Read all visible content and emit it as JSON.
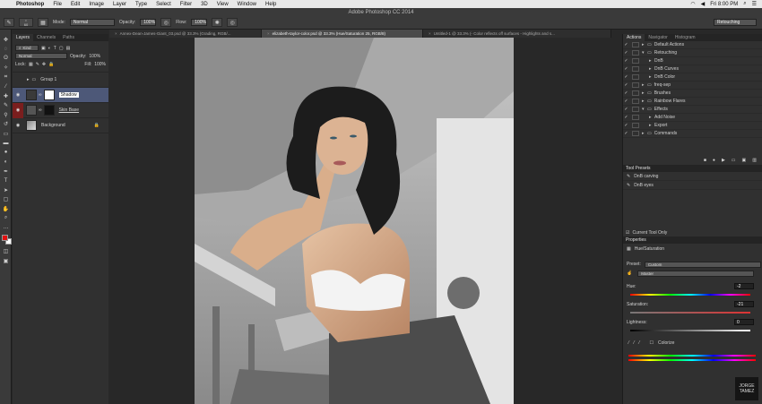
{
  "menubar": {
    "app": "Photoshop",
    "items": [
      "File",
      "Edit",
      "Image",
      "Layer",
      "Type",
      "Select",
      "Filter",
      "3D",
      "View",
      "Window",
      "Help"
    ],
    "clock": "Fri 8:00 PM"
  },
  "options": {
    "title": "Adobe Photoshop CC 2014",
    "brush_size": "60",
    "mode_label": "Mode:",
    "mode_value": "Normal",
    "opacity_label": "Opacity:",
    "opacity_value": "100%",
    "flow_label": "Flow:",
    "flow_value": "100%",
    "workspace": "Retouching"
  },
  "tabs": [
    {
      "label": "Annex-Dean-James-Giant_03.psd @ 33.3% (Grading, RGB/..."
    },
    {
      "label": "elizabeth-taylor-color.psd @ 33.3% (Hue/Saturation 25, RGB/8)"
    },
    {
      "label": "Untitled-1 @ 33.3% (- Color reflects off surfaces - Highlights and s..."
    }
  ],
  "layers_panel": {
    "tabs": [
      "Layers",
      "Channels",
      "Paths"
    ],
    "filter": "Kind",
    "blend": "Normal",
    "opacity_label": "Opacity:",
    "opacity_value": "100%",
    "lock_label": "Lock:",
    "fill_label": "Fill:",
    "fill_value": "100%",
    "layers": [
      {
        "name": "Group 1"
      },
      {
        "name": "Shadow"
      },
      {
        "name": "Skin Base"
      },
      {
        "name": "Background"
      }
    ]
  },
  "actions_panel": {
    "tabs": [
      "Actions",
      "Navigator",
      "Histogram"
    ],
    "items": [
      {
        "label": "Default Actions"
      },
      {
        "label": "Retouching"
      },
      {
        "label": "DnB"
      },
      {
        "label": "DnB Curves"
      },
      {
        "label": "DnB Color"
      },
      {
        "label": "freq-sep"
      },
      {
        "label": "Brushes"
      },
      {
        "label": "Rainbow Flares"
      },
      {
        "label": "Effects"
      },
      {
        "label": "Add Noise"
      },
      {
        "label": "Export"
      },
      {
        "label": "Commands"
      }
    ]
  },
  "tool_presets": {
    "title": "Tool Presets",
    "items": [
      {
        "label": "DnB carving"
      },
      {
        "label": "DnB eyes"
      }
    ],
    "current_only": "Current Tool Only"
  },
  "properties": {
    "title": "Properties",
    "adjustment": "Hue/Saturation",
    "preset_label": "Preset:",
    "preset_value": "Custom",
    "channel": "Master",
    "hue_label": "Hue:",
    "hue_value": "-2",
    "saturation_label": "Saturation:",
    "saturation_value": "-21",
    "lightness_label": "Lightness:",
    "lightness_value": "0",
    "colorize_label": "Colorize"
  },
  "watermark": {
    "line1": "JORGE",
    "line2": "TAMEZ"
  }
}
